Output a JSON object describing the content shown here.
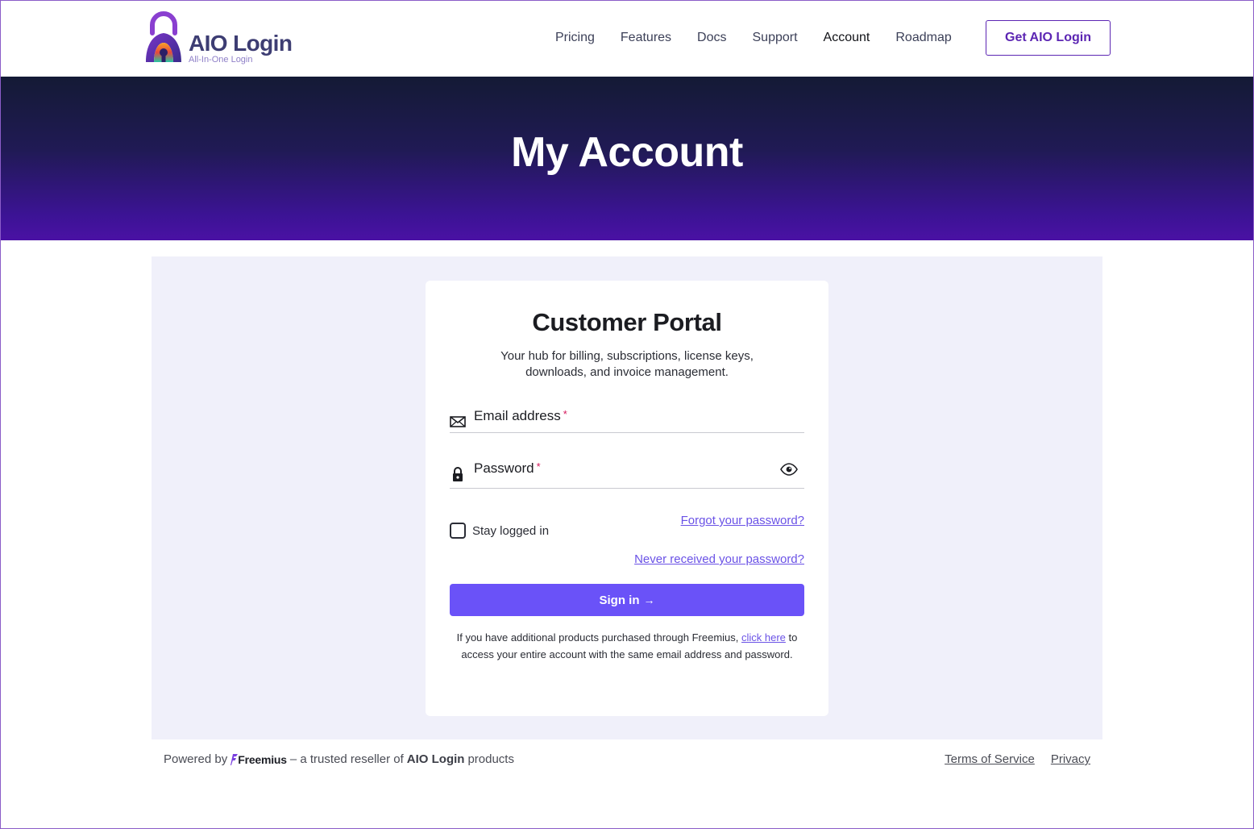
{
  "brand": {
    "name": "AIO Login",
    "tagline": "All-In-One Login",
    "colors": {
      "primary": "#5c26b3",
      "accent": "#6a52f8",
      "hero_dark": "#141a35",
      "hero_purple": "#4a11a4",
      "panel_bg": "#f0f0fa"
    }
  },
  "nav": {
    "items": [
      {
        "label": "Pricing",
        "active": false
      },
      {
        "label": "Features",
        "active": false
      },
      {
        "label": "Docs",
        "active": false
      },
      {
        "label": "Support",
        "active": false
      },
      {
        "label": "Account",
        "active": true
      },
      {
        "label": "Roadmap",
        "active": false
      }
    ],
    "cta_label": "Get AIO Login"
  },
  "hero": {
    "title": "My Account"
  },
  "portal": {
    "title": "Customer Portal",
    "subtitle": "Your hub for billing, subscriptions, license keys, downloads, and invoice management.",
    "email": {
      "label": "Email address",
      "required_mark": "*",
      "value": "",
      "icon": "envelope-icon"
    },
    "password": {
      "label": "Password",
      "required_mark": "*",
      "value": "",
      "icon": "lock-icon",
      "toggle_icon": "eye-icon"
    },
    "remember": {
      "label": "Stay logged in",
      "checked": false
    },
    "forgot_link": "Forgot your password?",
    "never_link": "Never received your password?",
    "sign_in_label": "Sign in",
    "sign_in_arrow": "→",
    "note": {
      "before": "If you have additional products purchased through Freemius, ",
      "link": "click here",
      "after": " to access your entire account with the same email address and password."
    }
  },
  "footer": {
    "powered_prefix": "Powered by",
    "reseller_name": "Freemius",
    "reseller_text": "– a trusted reseller of",
    "product_name": "AIO Login",
    "suffix": "products",
    "links": {
      "terms": "Terms of Service",
      "privacy": "Privacy"
    }
  }
}
